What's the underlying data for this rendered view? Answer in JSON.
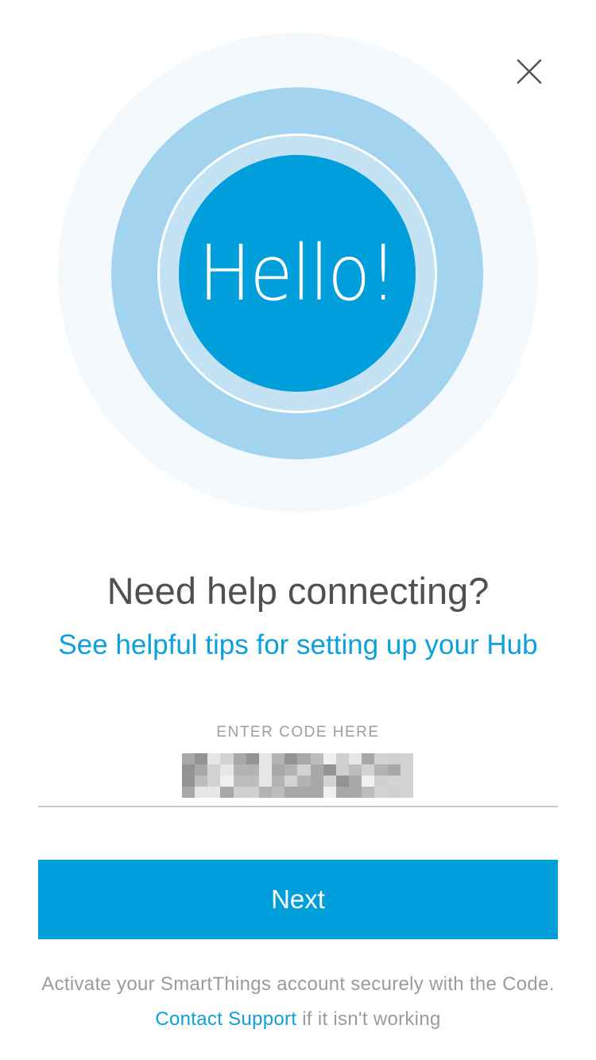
{
  "header": {
    "close_icon": "close-icon"
  },
  "hero": {
    "greeting": "Hello!",
    "colors": {
      "outer": "#f3f9fc",
      "middle": "#a2d3ef",
      "inner": "#c3e3f5",
      "core": "#009fdc"
    }
  },
  "help": {
    "heading": "Need help connecting?",
    "tips_link": "See helpful tips for setting up your Hub"
  },
  "code_entry": {
    "label": "ENTER CODE HERE",
    "value_state": "obscured"
  },
  "actions": {
    "next_label": "Next"
  },
  "footer": {
    "activate_text": "Activate your SmartThings account securely with the Code.",
    "contact_link": "Contact Support",
    "contact_suffix": " if it isn't working"
  },
  "theme": {
    "accent": "#009fdc",
    "link": "#0ca0dc",
    "heading_text": "#505050",
    "muted_text": "#9b9b9b"
  }
}
